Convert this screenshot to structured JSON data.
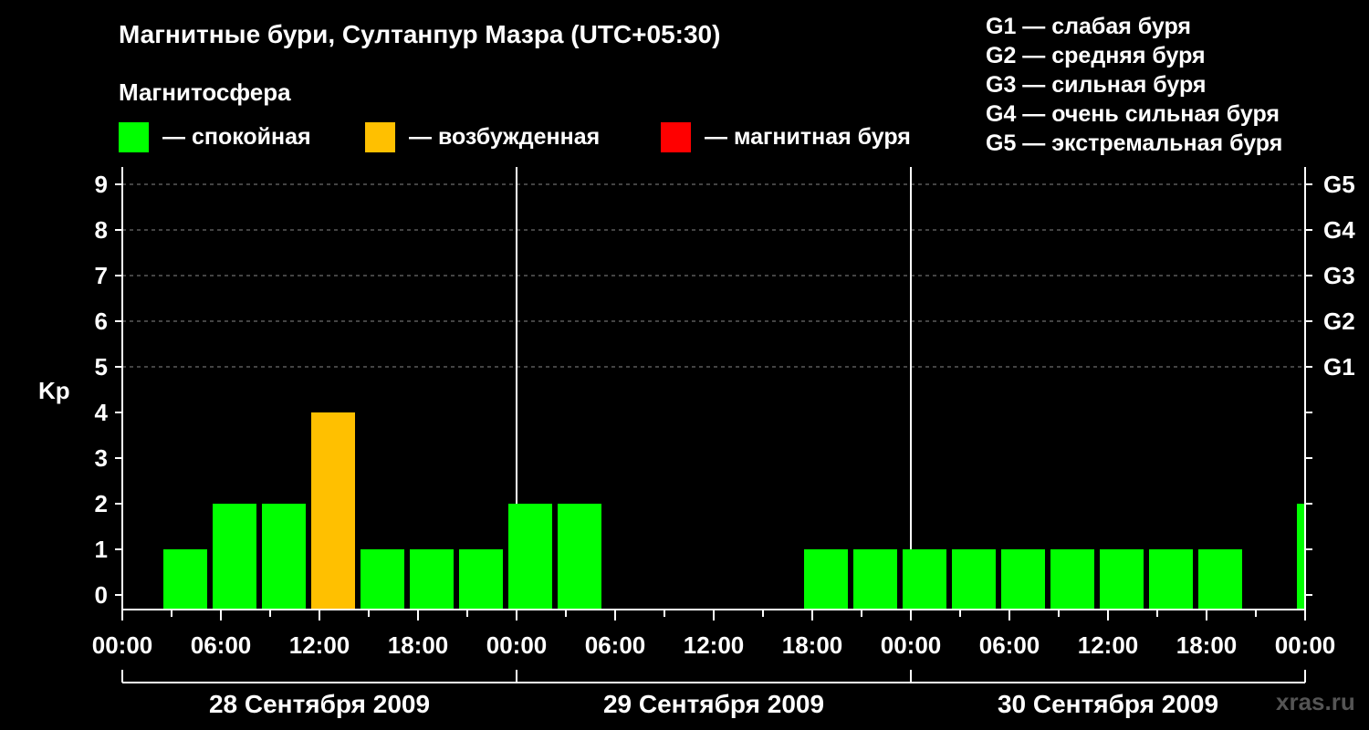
{
  "header": {
    "title": "Магнитные бури, Султанпур Мазра (UTC+05:30)",
    "legend_title": "Магнитосфера"
  },
  "legend": [
    {
      "label": "— спокойная",
      "color": "#00ff00"
    },
    {
      "label": "— возбужденная",
      "color": "#ffc000"
    },
    {
      "label": "— магнитная буря",
      "color": "#ff0000"
    }
  ],
  "g_scale": [
    "G1 — слабая буря",
    "G2 — средняя буря",
    "G3 — сильная буря",
    "G4 — очень сильная буря",
    "G5 — экстремальная буря"
  ],
  "watermark": "xras.ru",
  "colors": {
    "quiet": "#00ff00",
    "unsettled": "#ffc000",
    "storm": "#ff0000",
    "background": "#000000",
    "grid": "#888888"
  },
  "chart_data": {
    "type": "bar",
    "ylabel": "Kp",
    "ylim": [
      0,
      9
    ],
    "yticks": [
      "0",
      "1",
      "2",
      "3",
      "4",
      "5",
      "6",
      "7",
      "8",
      "9"
    ],
    "right_ticks": [
      {
        "kp": 5,
        "label": "G1"
      },
      {
        "kp": 6,
        "label": "G2"
      },
      {
        "kp": 7,
        "label": "G3"
      },
      {
        "kp": 8,
        "label": "G4"
      },
      {
        "kp": 9,
        "label": "G5"
      }
    ],
    "xticks": [
      "00:00",
      "06:00",
      "12:00",
      "18:00",
      "00:00",
      "06:00",
      "12:00",
      "18:00",
      "00:00",
      "06:00",
      "12:00",
      "18:00",
      "00:00"
    ],
    "dates": [
      "28 Сентября 2009",
      "29 Сентября 2009",
      "30 Сентября 2009"
    ],
    "x_range_hours": [
      0,
      72
    ],
    "grid": "horizontal dashed at 5–9",
    "bars": [
      {
        "start_hour": 2.5,
        "kp": 1,
        "level": "quiet"
      },
      {
        "start_hour": 5.5,
        "kp": 2,
        "level": "quiet"
      },
      {
        "start_hour": 8.5,
        "kp": 2,
        "level": "quiet"
      },
      {
        "start_hour": 11.5,
        "kp": 4,
        "level": "unsettled"
      },
      {
        "start_hour": 14.5,
        "kp": 1,
        "level": "quiet"
      },
      {
        "start_hour": 17.5,
        "kp": 1,
        "level": "quiet"
      },
      {
        "start_hour": 20.5,
        "kp": 1,
        "level": "quiet"
      },
      {
        "start_hour": 23.5,
        "kp": 2,
        "level": "quiet"
      },
      {
        "start_hour": 26.5,
        "kp": 2,
        "level": "quiet"
      },
      {
        "start_hour": 41.5,
        "kp": 1,
        "level": "quiet"
      },
      {
        "start_hour": 44.5,
        "kp": 1,
        "level": "quiet"
      },
      {
        "start_hour": 47.5,
        "kp": 1,
        "level": "quiet"
      },
      {
        "start_hour": 50.5,
        "kp": 1,
        "level": "quiet"
      },
      {
        "start_hour": 53.5,
        "kp": 1,
        "level": "quiet"
      },
      {
        "start_hour": 56.5,
        "kp": 1,
        "level": "quiet"
      },
      {
        "start_hour": 59.5,
        "kp": 1,
        "level": "quiet"
      },
      {
        "start_hour": 62.5,
        "kp": 1,
        "level": "quiet"
      },
      {
        "start_hour": 65.5,
        "kp": 1,
        "level": "quiet"
      },
      {
        "start_hour": 71.5,
        "kp": 2,
        "level": "quiet"
      }
    ]
  }
}
